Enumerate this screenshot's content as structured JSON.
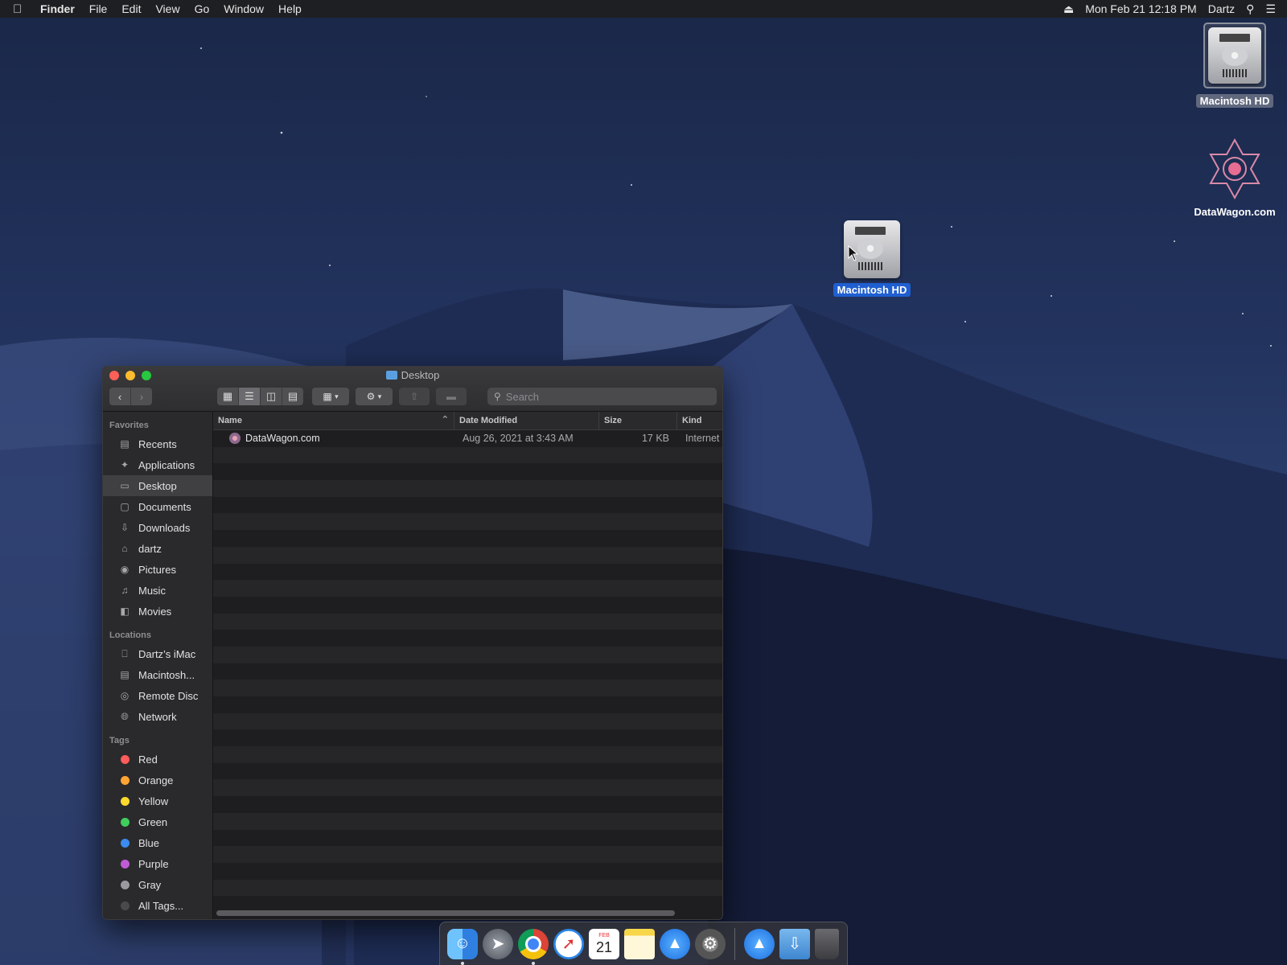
{
  "menubar": {
    "app": "Finder",
    "items": [
      "File",
      "Edit",
      "View",
      "Go",
      "Window",
      "Help"
    ],
    "datetime": "Mon Feb 21  12:18 PM",
    "user": "Dartz"
  },
  "desktop": {
    "icons": [
      {
        "label": "Macintosh HD"
      },
      {
        "label": "DataWagon.com"
      },
      {
        "label": "Macintosh HD"
      }
    ]
  },
  "window": {
    "title": "Desktop",
    "search_placeholder": "Search",
    "sidebar": {
      "favorites_header": "Favorites",
      "favorites": [
        {
          "label": "Recents",
          "icon": "recents-icon"
        },
        {
          "label": "Applications",
          "icon": "applications-icon"
        },
        {
          "label": "Desktop",
          "icon": "desktop-icon",
          "active": true
        },
        {
          "label": "Documents",
          "icon": "documents-icon"
        },
        {
          "label": "Downloads",
          "icon": "downloads-icon"
        },
        {
          "label": "dartz",
          "icon": "home-icon"
        },
        {
          "label": "Pictures",
          "icon": "pictures-icon"
        },
        {
          "label": "Music",
          "icon": "music-icon"
        },
        {
          "label": "Movies",
          "icon": "movies-icon"
        }
      ],
      "locations_header": "Locations",
      "locations": [
        {
          "label": "Dartz’s iMac",
          "icon": "computer-icon"
        },
        {
          "label": "Macintosh...",
          "icon": "disk-icon"
        },
        {
          "label": "Remote Disc",
          "icon": "disc-icon"
        },
        {
          "label": "Network",
          "icon": "network-icon"
        }
      ],
      "tags_header": "Tags",
      "tags": [
        {
          "label": "Red",
          "color": "#ff5b5b"
        },
        {
          "label": "Orange",
          "color": "#ffa533"
        },
        {
          "label": "Yellow",
          "color": "#ffd92e"
        },
        {
          "label": "Green",
          "color": "#3fcf5c"
        },
        {
          "label": "Blue",
          "color": "#3b8cf0"
        },
        {
          "label": "Purple",
          "color": "#c05bd6"
        },
        {
          "label": "Gray",
          "color": "#9b9b9f"
        },
        {
          "label": "All Tags...",
          "color": "#4a4a4d"
        }
      ]
    },
    "columns": {
      "name": "Name",
      "date": "Date Modified",
      "size": "Size",
      "kind": "Kind"
    },
    "files": [
      {
        "name": "DataWagon.com",
        "date": "Aug 26, 2021 at 3:43 AM",
        "size": "17 KB",
        "kind": "Internet"
      }
    ]
  },
  "dock": {
    "apps": [
      "finder-icon",
      "launchpad-icon",
      "chrome-icon",
      "safari-icon",
      "calendar-icon",
      "notes-icon",
      "app-store-icon",
      "system-preferences-icon"
    ],
    "calendar_month": "FEB",
    "calendar_day": "21"
  }
}
